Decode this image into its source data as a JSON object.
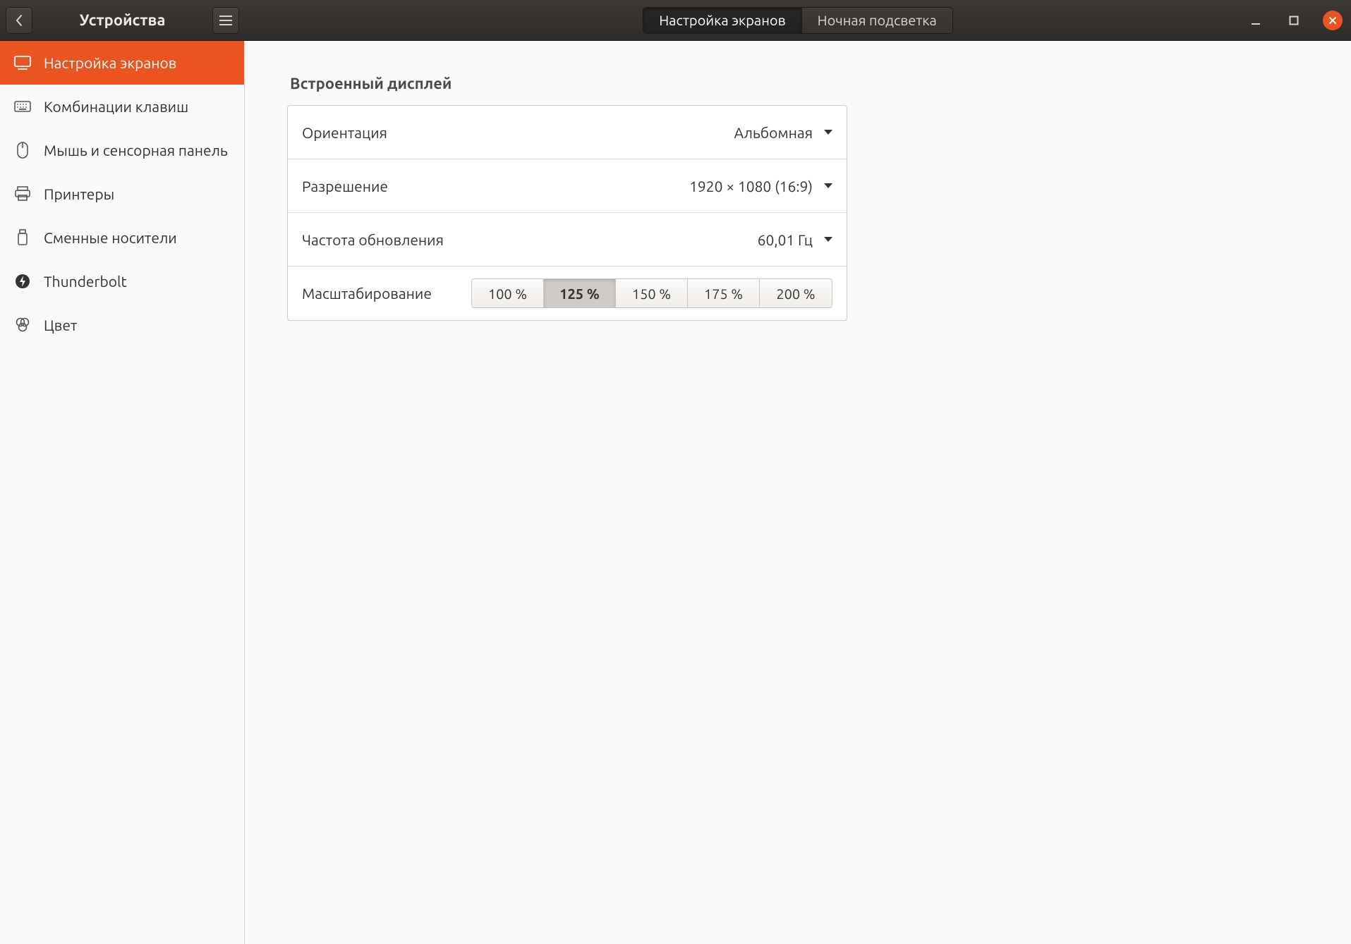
{
  "header": {
    "title": "Устройства",
    "tabs": [
      {
        "label": "Настройка экранов",
        "selected": true
      },
      {
        "label": "Ночная подсветка",
        "selected": false
      }
    ]
  },
  "sidebar": {
    "items": [
      {
        "label": "Настройка экранов",
        "icon": "displays-icon",
        "active": true
      },
      {
        "label": "Комбинации клавиш",
        "icon": "keyboard-icon",
        "active": false
      },
      {
        "label": "Мышь и сенсорная панель",
        "icon": "mouse-icon",
        "active": false
      },
      {
        "label": "Принтеры",
        "icon": "printer-icon",
        "active": false
      },
      {
        "label": "Сменные носители",
        "icon": "removable-media-icon",
        "active": false
      },
      {
        "label": "Thunderbolt",
        "icon": "thunderbolt-icon",
        "active": false
      },
      {
        "label": "Цвет",
        "icon": "color-icon",
        "active": false
      }
    ]
  },
  "main": {
    "section_label": "Встроенный дисплей",
    "rows": {
      "orientation": {
        "label": "Ориентация",
        "value": "Альбомная"
      },
      "resolution": {
        "label": "Разрешение",
        "value": "1920 × 1080 (16:9)"
      },
      "refresh": {
        "label": "Частота обновления",
        "value": "60,01 Гц"
      },
      "scale": {
        "label": "Масштабирование",
        "options": [
          "100 %",
          "125 %",
          "150 %",
          "175 %",
          "200 %"
        ],
        "selected_index": 1
      }
    }
  },
  "colors": {
    "accent": "#e95420"
  }
}
